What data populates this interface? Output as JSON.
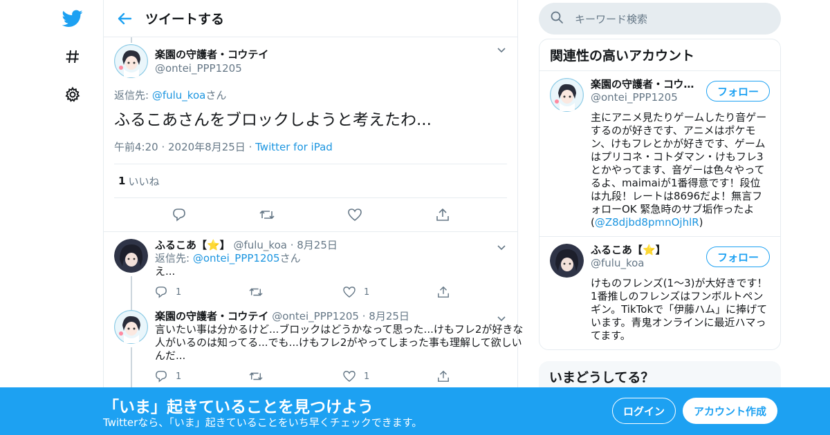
{
  "colors": {
    "accent": "#1da1f2",
    "link": "#1b95e0",
    "muted": "#657786",
    "border": "#e6ecf0"
  },
  "nav": {
    "icons": [
      "twitter-bird-icon",
      "hashtag-icon",
      "gear-icon"
    ]
  },
  "header": {
    "title": "ツイートする"
  },
  "main_tweet": {
    "name": "楽園の守護者・コウテイ",
    "handle": "@ontei_PPP1205",
    "reply_prefix": "返信先: ",
    "reply_to": "@fulu_koa",
    "reply_suffix": "さん",
    "text": "ふるこあさんをブロックしようと考えたわ...",
    "time": "午前4:20",
    "date": "2020年8月25日",
    "client": "Twitter for iPad",
    "like_count": "1",
    "like_label": "いいね"
  },
  "replies": [
    {
      "name": "ふるこあ【⭐】",
      "handle": "@fulu_koa",
      "date": "8月25日",
      "reply_prefix": "返信先: ",
      "reply_to": "@ontei_PPP1205",
      "reply_suffix": "さん",
      "text": "え...",
      "reply_count": "1",
      "like_count": "1"
    },
    {
      "name": "楽園の守護者・コウテイ",
      "handle": "@ontei_PPP1205",
      "date": "8月25日",
      "text": "言いたい事は分かるけど...ブロックはどうかなって思った...けもフレ2が好きな人がいるのは知ってる...でも...けもフレ2がやってしまった事も理解して欲しいんだ...",
      "reply_count": "1",
      "like_count": "1"
    }
  ],
  "search": {
    "placeholder": "キーワード検索"
  },
  "related": {
    "title": "関連性の高いアカウント",
    "follow_label": "フォロー",
    "accounts": [
      {
        "name": "楽園の守護者・コウテイ",
        "handle": "@ontei_PPP1205",
        "bio": "主にアニメ見たりゲームしたり音ゲーするのが好きです、アニメはポケモン、けもフレとかが好きです、ゲームはプリコネ・コトダマン・けもフレ3とかやってます、音ゲーは色々やってるよ、maimaiが1番得意です！段位は九段！レートは8696だよ！無言フォローOK 緊急時のサブ垢作ったよ(",
        "bio_link": "@Z8djbd8pmnOjhlR",
        "bio_end": ")"
      },
      {
        "name": "ふるこあ【⭐】",
        "handle": "@fulu_koa",
        "bio": "けものフレンズ(1〜3)が大好きです！1番推しのフレンズはフンボルトペンギン。TikTokで「伊藤ハム」に捧げています。青鬼オンラインに最近ハマってます。"
      }
    ]
  },
  "trends": {
    "title": "いまどうしてる？"
  },
  "banner": {
    "title": "「いま」起きていることを見つけよう",
    "subtitle": "Twitterなら、「いま」起きていることをいち早くチェックできます。",
    "login": "ログイン",
    "signup": "アカウント作成"
  }
}
